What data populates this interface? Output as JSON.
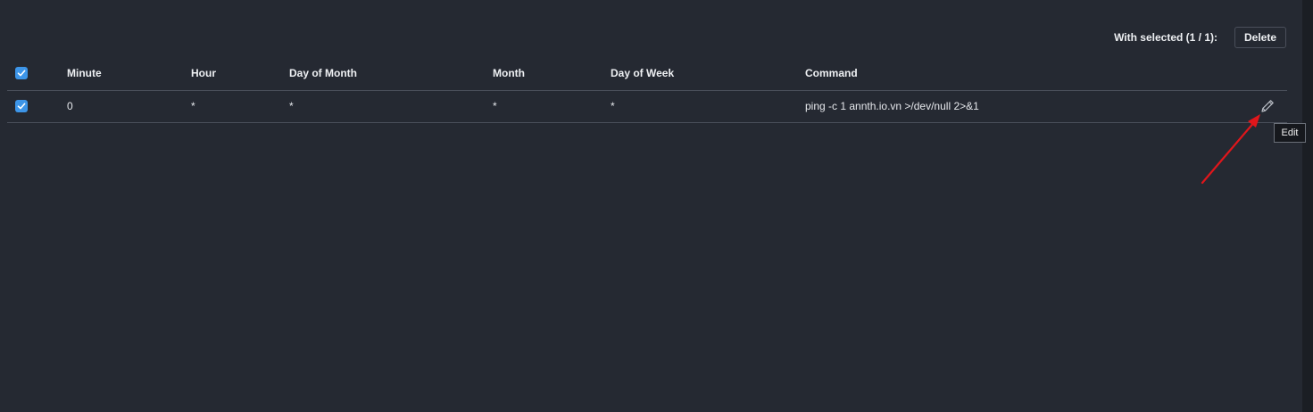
{
  "toolbar": {
    "with_selected": "With selected (1 / 1):",
    "delete_label": "Delete"
  },
  "table": {
    "columns": [
      "Minute",
      "Hour",
      "Day of Month",
      "Month",
      "Day of Week",
      "Command"
    ],
    "rows": [
      {
        "checked": true,
        "minute": "0",
        "hour": "*",
        "day_of_month": "*",
        "month": "*",
        "day_of_week": "*",
        "command": "ping -c 1 annth.io.vn >/dev/null 2>&1"
      }
    ]
  },
  "tooltip": {
    "text": "Edit"
  },
  "icons": {
    "edit": "pencil-icon",
    "select_all": "checkbox-checked-icon"
  },
  "colors": {
    "background": "#252932",
    "checkbox": "#3d95e8",
    "annotation_arrow": "#e0161b"
  }
}
